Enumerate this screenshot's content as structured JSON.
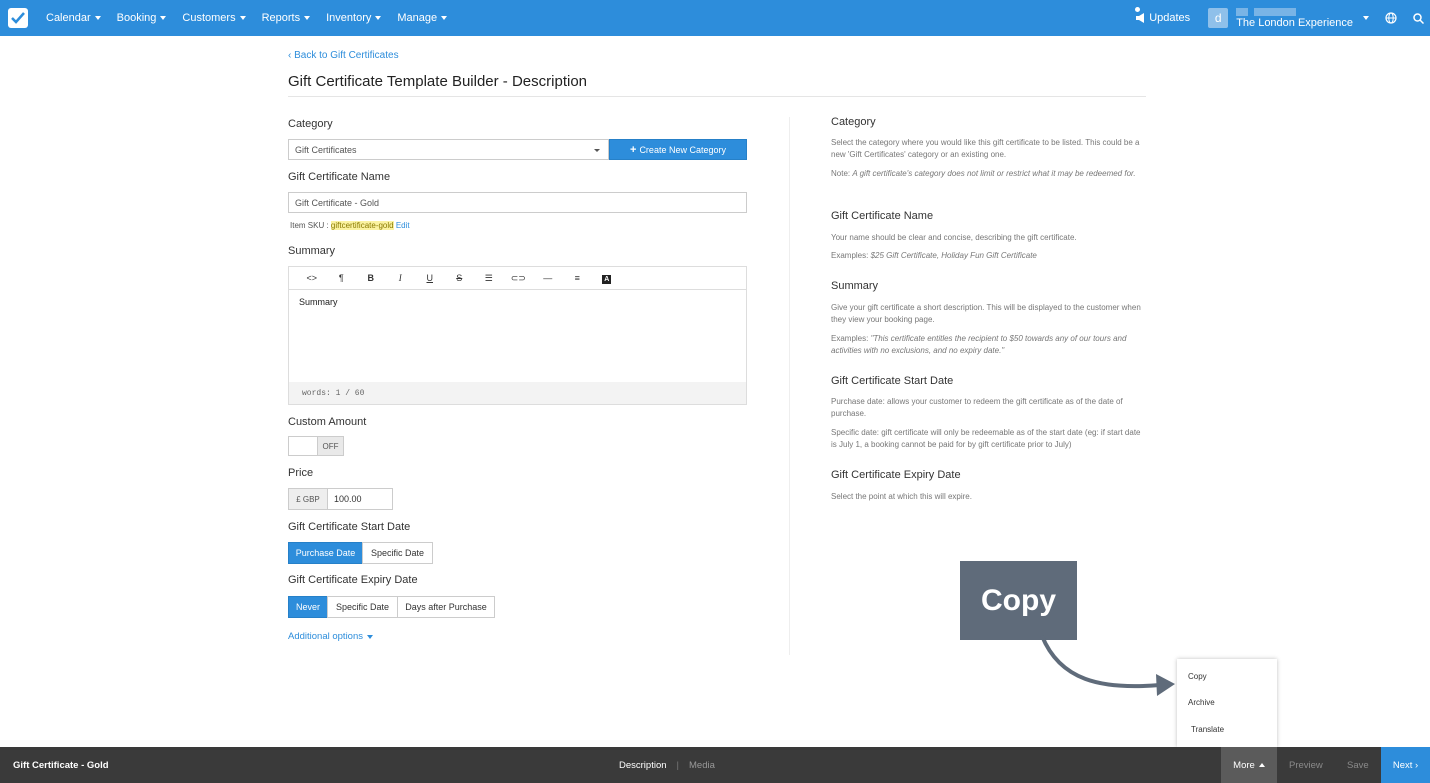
{
  "nav": {
    "items": [
      {
        "label": "Calendar"
      },
      {
        "label": "Booking"
      },
      {
        "label": "Customers"
      },
      {
        "label": "Reports"
      },
      {
        "label": "Inventory"
      },
      {
        "label": "Manage"
      }
    ],
    "updates_label": "Updates",
    "avatar_letter": "d",
    "account_name": "The London Experience"
  },
  "page": {
    "back_link": "‹ Back to Gift Certificates",
    "title": "Gift Certificate Template Builder - Description"
  },
  "form": {
    "category_label": "Category",
    "category_value": "Gift Certificates",
    "create_category_label": "Create New Category",
    "name_label": "Gift Certificate Name",
    "name_value": "Gift Certificate - Gold",
    "sku_prefix": "Item SKU : ",
    "sku_value": "giftcertificate-gold",
    "sku_edit": "Edit",
    "summary_label": "Summary",
    "summary_text": "Summary",
    "word_count": "words: 1 / 60",
    "custom_amount_label": "Custom Amount",
    "custom_amount_state": "OFF",
    "price_label": "Price",
    "price_currency": "£ GBP",
    "price_value": "100.00",
    "start_date_label": "Gift Certificate Start Date",
    "start_options": [
      "Purchase Date",
      "Specific Date"
    ],
    "expiry_label": "Gift Certificate Expiry Date",
    "expiry_options": [
      "Never",
      "Specific Date",
      "Days after Purchase"
    ],
    "additional_options": "Additional options"
  },
  "editor_toolbar": [
    "code-icon",
    "paragraph-icon",
    "bold-icon",
    "italic-icon",
    "underline-icon",
    "strikethrough-icon",
    "list-icon",
    "link-icon",
    "hr-icon",
    "align-icon",
    "color-icon"
  ],
  "help": {
    "category_h": "Category",
    "category_p1": "Select the category where you would like this gift certificate to be listed. This could be a new 'Gift Certificates' category or an existing one.",
    "category_note_prefix": "Note: ",
    "category_note": "A gift certificate's category does not limit or restrict what it may be redeemed for.",
    "name_h": "Gift Certificate Name",
    "name_p1": "Your name should be clear and concise, describing the gift certificate.",
    "name_examples_prefix": "Examples: ",
    "name_examples": "$25 Gift Certificate, Holiday Fun Gift Certificate",
    "summary_h": "Summary",
    "summary_p1": "Give your gift certificate a short description. This will be displayed to the customer when they view your booking page.",
    "summary_examples_prefix": "Examples: ",
    "summary_examples": "\"This certificate entitles the recipient to $50 towards any of our tours and activities with no exclusions, and no expiry date.\"",
    "start_h": "Gift Certificate Start Date",
    "start_p1": "Purchase date: allows your customer to redeem the gift certificate as of the date of purchase.",
    "start_p2": "Specific date: gift certificate will only be redeemable as of the start date (eg: if start date is July 1, a booking cannot be paid for by gift certificate prior to July)",
    "expiry_h": "Gift Certificate Expiry Date",
    "expiry_p1": "Select the point at which this will expire."
  },
  "callout": {
    "label": "Copy"
  },
  "more_menu": {
    "items": [
      "Copy",
      "Archive",
      "Translate"
    ]
  },
  "bottom": {
    "title": "Gift Certificate - Gold",
    "tab_description": "Description",
    "tab_media": "Media",
    "more": "More",
    "preview": "Preview",
    "save": "Save",
    "next": "Next ›"
  },
  "colors": {
    "primary": "#2d8ddb",
    "bottom_bar": "#3a3a3a",
    "callout": "#5f6b7a"
  }
}
